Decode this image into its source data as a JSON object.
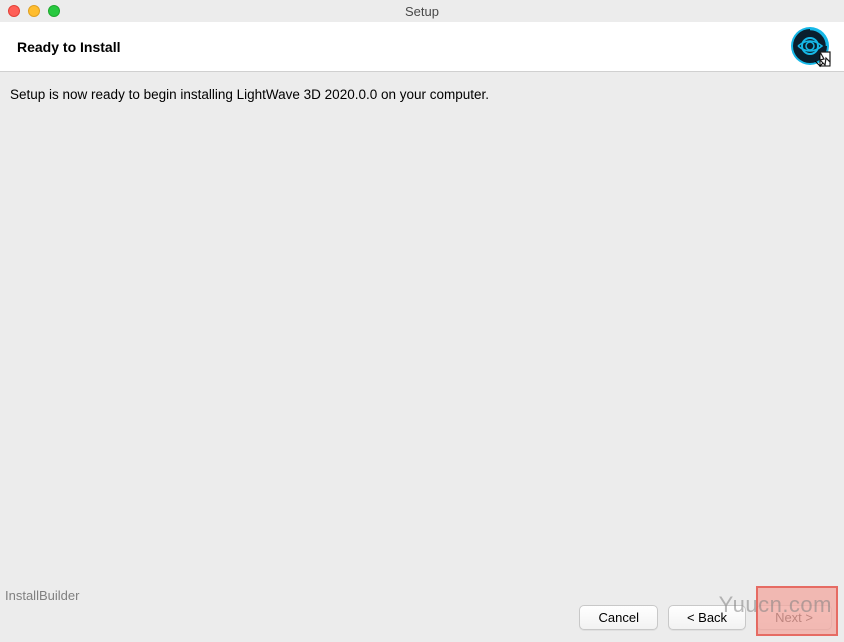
{
  "window": {
    "title": "Setup"
  },
  "header": {
    "title": "Ready to Install"
  },
  "content": {
    "message": "Setup is now ready to begin installing LightWave 3D 2020.0.0 on your computer."
  },
  "footer": {
    "builder": "InstallBuilder",
    "buttons": {
      "cancel": "Cancel",
      "back": "< Back",
      "next": "Next >"
    }
  },
  "watermark": "Yuucn.com"
}
